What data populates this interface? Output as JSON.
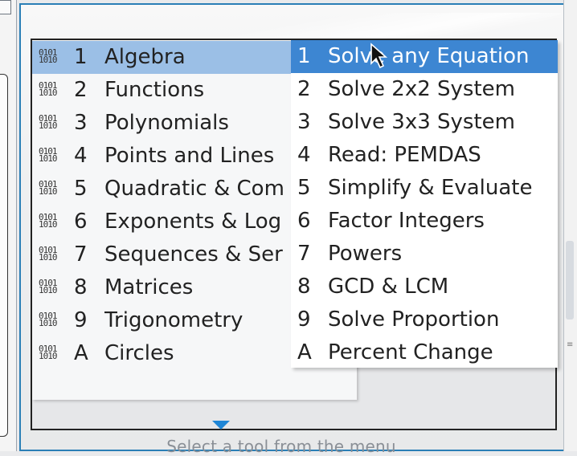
{
  "hint": "Select a tool from the menu",
  "category_menu": [
    {
      "num": "1",
      "label": "Algebra",
      "selected": true
    },
    {
      "num": "2",
      "label": "Functions"
    },
    {
      "num": "3",
      "label": "Polynomials"
    },
    {
      "num": "4",
      "label": "Points and Lines"
    },
    {
      "num": "5",
      "label": "Quadratic & Com"
    },
    {
      "num": "6",
      "label": "Exponents & Log"
    },
    {
      "num": "7",
      "label": "Sequences & Ser"
    },
    {
      "num": "8",
      "label": "Matrices"
    },
    {
      "num": "9",
      "label": "Trigonometry"
    },
    {
      "num": "A",
      "label": "Circles"
    }
  ],
  "submenu": [
    {
      "num": "1",
      "label": "Solve any Equation",
      "selected": true
    },
    {
      "num": "2",
      "label": "Solve 2x2 System"
    },
    {
      "num": "3",
      "label": "Solve 3x3 System"
    },
    {
      "num": "4",
      "label": "Read: PEMDAS"
    },
    {
      "num": "5",
      "label": "Simplify & Evaluate"
    },
    {
      "num": "6",
      "label": "Factor Integers"
    },
    {
      "num": "7",
      "label": "Powers"
    },
    {
      "num": "8",
      "label": "GCD & LCM"
    },
    {
      "num": "9",
      "label": "Solve Proportion"
    },
    {
      "num": "A",
      "label": "Percent Change"
    }
  ],
  "icons": {
    "menu_item": "program-icon",
    "more": "chevron-down-icon",
    "pointer": "mouse-pointer-icon"
  },
  "colors": {
    "panel_border": "#2a7fb6",
    "category_selected": "#9bbfe6",
    "submenu_selected": "#3d86d2",
    "scroll_arrow": "#1f86d6"
  }
}
